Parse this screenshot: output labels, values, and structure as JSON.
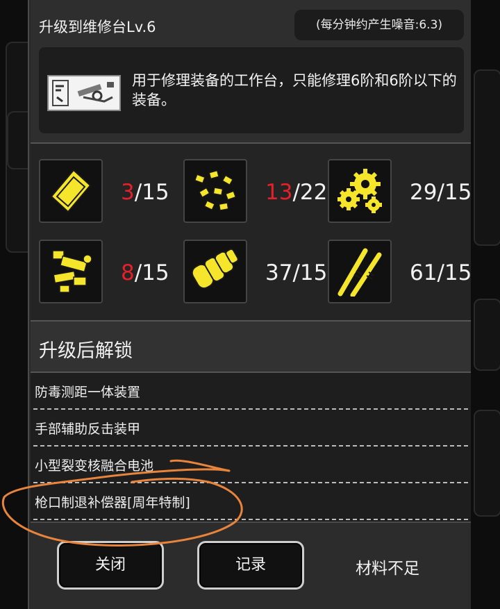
{
  "dialog": {
    "title": "升级到维修台Lv.6",
    "noise_badge": "(每分钟约产生噪音:6.3)",
    "description": "用于修理装备的工作台，只能修理6阶和6阶以下的装备。",
    "accent_red": "#e4202a",
    "icon_yellow": "#f5e62c"
  },
  "materials": [
    {
      "icon": "metal-plate-icon",
      "have": "3",
      "need": "/15",
      "sufficient": false
    },
    {
      "icon": "scrap-parts-icon",
      "have": "13",
      "need": "/22",
      "sufficient": false
    },
    {
      "icon": "gears-icon",
      "have": "29",
      "need": "/15",
      "sufficient": true
    },
    {
      "icon": "circuit-parts-icon",
      "have": "8",
      "need": "/15",
      "sufficient": false
    },
    {
      "icon": "tube-connector-icon",
      "have": "37",
      "need": "/15",
      "sufficient": true
    },
    {
      "icon": "wires-icon",
      "have": "61",
      "need": "/15",
      "sufficient": true
    }
  ],
  "unlock": {
    "title": "升级后解锁",
    "items": [
      "防毒测距一体装置",
      "手部辅助反击装甲",
      "小型裂变核融合电池",
      "枪口制退补偿器[周年特制]"
    ]
  },
  "footer": {
    "close_label": "关闭",
    "record_label": "记录",
    "status": "材料不足"
  },
  "annotation_color": "#e8843c"
}
